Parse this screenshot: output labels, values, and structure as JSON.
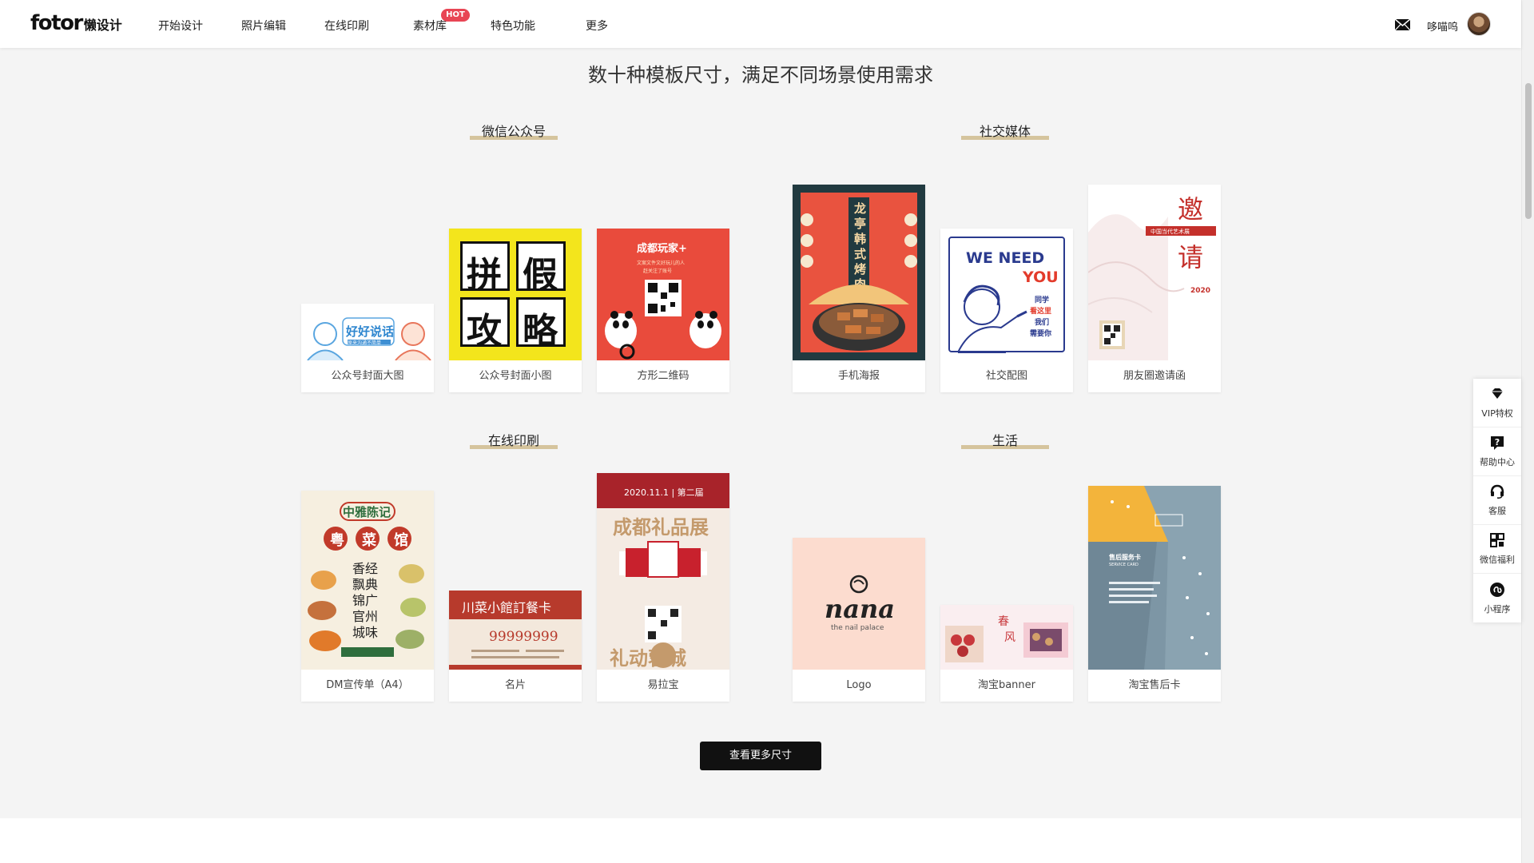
{
  "header": {
    "logo_word": "fotor",
    "logo_sub": "懒设计",
    "nav": [
      "开始设计",
      "照片编辑",
      "在线印刷",
      "素材库",
      "特色功能",
      "更多"
    ],
    "hot_badge": "HOT",
    "username": "哆喵呜"
  },
  "main": {
    "title": "数十种模板尺寸，满足不同场景使用需求",
    "groups": [
      {
        "title": "微信公众号",
        "cards": [
          {
            "label": "公众号封面大图",
            "thumb_text": [
              "好好说话",
              "原来沟通不简单"
            ]
          },
          {
            "label": "公众号封面小图",
            "thumb_text": [
              "拼",
              "假",
              "攻",
              "略"
            ]
          },
          {
            "label": "方形二维码",
            "thumb_text": [
              "成都玩家+",
              "文案文件文好玩儿的人",
              "赶关注了账号"
            ]
          }
        ]
      },
      {
        "title": "社交媒体",
        "cards": [
          {
            "label": "手机海报",
            "thumb_text": [
              "龙亭韩式烤肉"
            ]
          },
          {
            "label": "社交配图",
            "thumb_text": [
              "WE NEED",
              "YOU",
              "同学",
              "看这里",
              "我们",
              "需要你"
            ]
          },
          {
            "label": "朋友圈邀请函",
            "thumb_text": [
              "邀",
              "请",
              "中国当代艺术展",
              "2020"
            ]
          }
        ]
      },
      {
        "title": "在线印刷",
        "cards": [
          {
            "label": "DM宣传单（A4）",
            "thumb_text": [
              "中雅陈记",
              "粤",
              "菜",
              "馆",
              "香经",
              "飘典",
              "锦广",
              "官州",
              "城味"
            ]
          },
          {
            "label": "名片",
            "thumb_text": [
              "川菜小館訂餐卡",
              "99999999"
            ]
          },
          {
            "label": "易拉宝",
            "thumb_text": [
              "2020.11.1 | 第二届",
              "成都礼品展",
              "礼动蓉城"
            ]
          }
        ]
      },
      {
        "title": "生活",
        "cards": [
          {
            "label": "Logo",
            "thumb_text": [
              "nana",
              "the nail palace"
            ]
          },
          {
            "label": "淘宝banner",
            "thumb_text": [
              "春",
              "风"
            ]
          },
          {
            "label": "淘宝售后卡",
            "thumb_text": [
              "售后服务卡",
              "SERVICE CARD"
            ]
          }
        ]
      }
    ],
    "more_button": "查看更多尺寸"
  },
  "side_panel": [
    "VIP特权",
    "帮助中心",
    "客服",
    "微信福利",
    "小程序"
  ],
  "colors": {
    "accent_bar": "#d5c49d",
    "hot_badge": "#e84554",
    "button_bg": "#111111"
  }
}
